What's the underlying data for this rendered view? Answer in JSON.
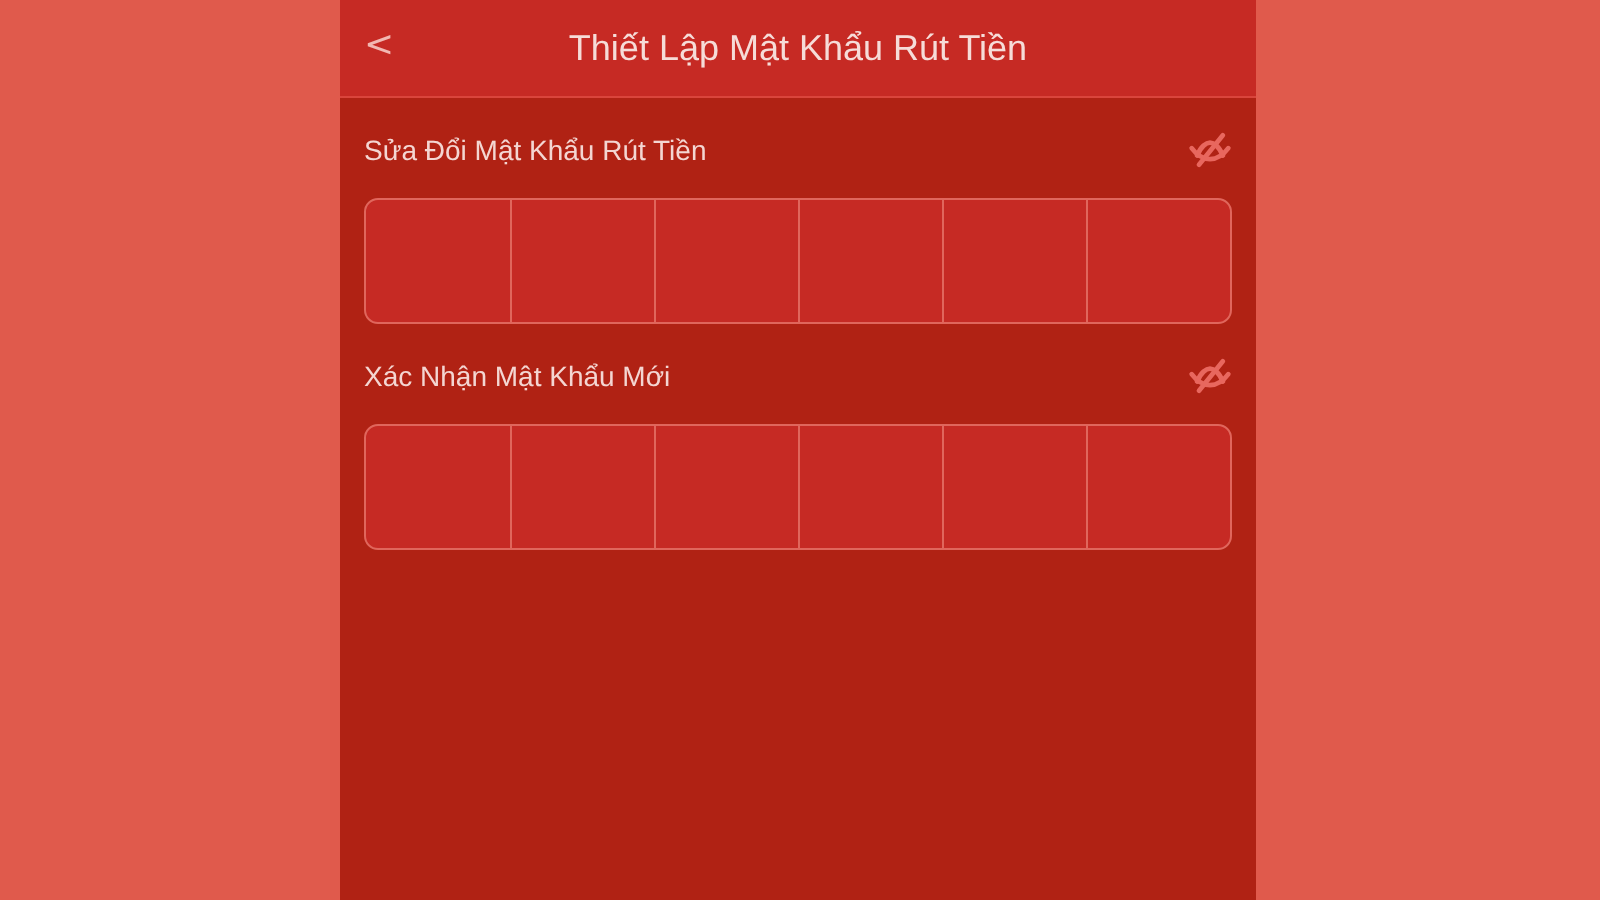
{
  "header": {
    "back": "<",
    "title": "Thiết Lập Mật Khẩu Rút Tiền"
  },
  "fields": [
    {
      "label": "Sửa Đổi Mật Khẩu Rút Tiền",
      "visible": false
    },
    {
      "label": "Xác Nhận Mật Khẩu Mới",
      "visible": false
    }
  ]
}
